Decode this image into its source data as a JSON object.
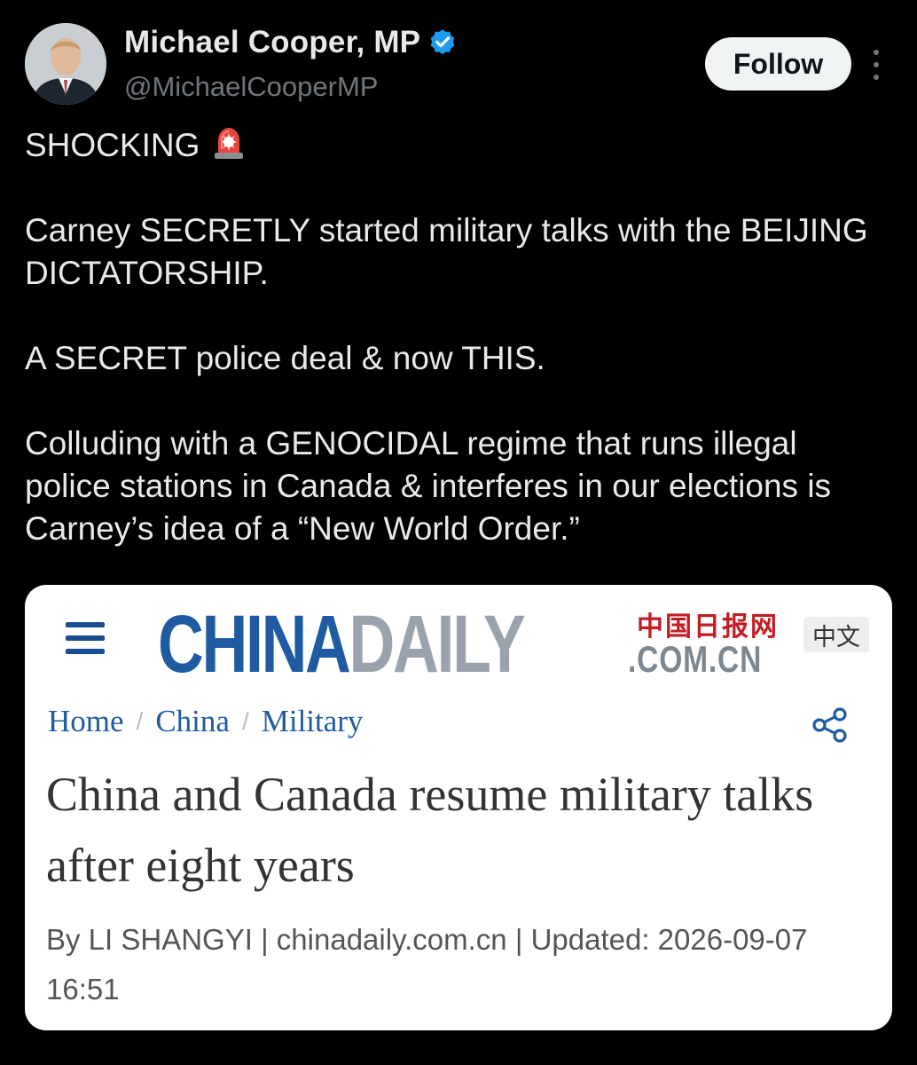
{
  "author": {
    "display_name": "Michael Cooper, MP",
    "handle": "@MichaelCooperMP",
    "verified": true,
    "verified_color": "#1d9bf0"
  },
  "actions": {
    "follow_label": "Follow"
  },
  "tweet": {
    "line_1": "SHOCKING",
    "line_2": "Carney SECRETLY started military talks with the BEIJING DICTATORSHIP.",
    "line_3": "A SECRET police deal & now THIS.",
    "line_4": "Colluding with a GENOCIDAL regime that runs illegal police stations in Canada & interferes in our elections is Carney’s idea of a “New World Order.”"
  },
  "card": {
    "logo_china": "CHINA",
    "logo_daily": "DAILY",
    "logo_cn_chars": "中国日报网",
    "logo_domain": ".COM.CN",
    "lang_badge": "中文",
    "breadcrumb": [
      "Home",
      "China",
      "Military"
    ],
    "headline": "China and Canada resume military talks after eight years",
    "byline": "By LI SHANGYI | chinadaily.com.cn | Updated: 2026-09-07 16:51",
    "brand_blue": "#1f5ba3",
    "brand_red": "#c21d24"
  }
}
